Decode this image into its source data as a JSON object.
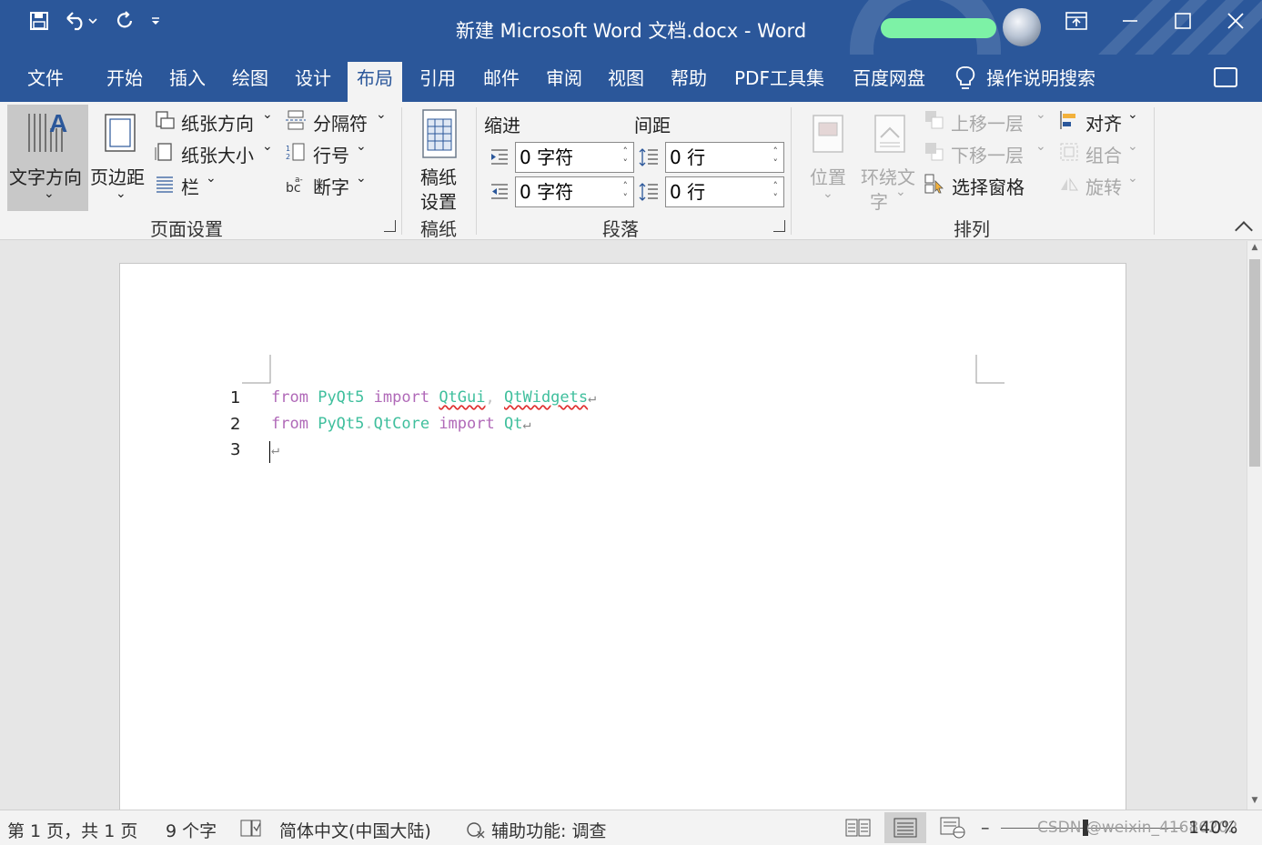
{
  "window": {
    "title": "新建 Microsoft Word 文档.docx  -  Word",
    "qat": [
      "save-icon",
      "undo-icon",
      "redo-icon",
      "customize-qat-icon"
    ],
    "controls": [
      "ribbon-display-icon",
      "minimize-icon",
      "maximize-icon",
      "close-icon"
    ]
  },
  "tabs": [
    "文件",
    "开始",
    "插入",
    "绘图",
    "设计",
    "布局",
    "引用",
    "邮件",
    "审阅",
    "视图",
    "帮助",
    "PDF工具集",
    "百度网盘"
  ],
  "active_tab": "布局",
  "tell_me": "操作说明搜索",
  "ribbon": {
    "page_setup": {
      "text_direction": "文字方向",
      "margins": "页边距",
      "orientation": "纸张方向",
      "size": "纸张大小",
      "columns": "栏",
      "breaks": "分隔符",
      "line_numbers": "行号",
      "hyphenation": "断字",
      "label": "页面设置"
    },
    "draft_paper": {
      "button_line1": "稿纸",
      "button_line2": "设置",
      "label": "稿纸"
    },
    "paragraph": {
      "indent_title": "缩进",
      "spacing_title": "间距",
      "indent_left": "0 字符",
      "indent_right": "0 字符",
      "spacing_before": "0 行",
      "spacing_after": "0 行",
      "label": "段落"
    },
    "arrange": {
      "position": "位置",
      "wrap_line1": "环绕文",
      "wrap_line2": "字",
      "bring_forward": "上移一层",
      "send_backward": "下移一层",
      "selection_pane": "选择窗格",
      "align": "对齐",
      "group": "组合",
      "rotate": "旋转",
      "label": "排列"
    }
  },
  "document": {
    "line_numbers": [
      "1",
      "2",
      "3"
    ],
    "line1": {
      "kw1": "from",
      "mod1": "PyQt5",
      "kw2": "import",
      "mod2": "QtGui",
      "punct": ",",
      "mod3": "QtWidgets"
    },
    "line2": {
      "kw1": "from",
      "mod1": "PyQt5",
      "punct": ".",
      "mod2": "QtCore",
      "kw2": "import",
      "mod3": "Qt"
    },
    "paragraph_mark": "↵"
  },
  "status": {
    "page": "第 1 页，共 1 页",
    "words": "9 个字",
    "language": "简体中文(中国大陆)",
    "accessibility": "辅助功能: 调查",
    "zoom_minus": "–",
    "zoom": "140%",
    "watermark": "CSDN @weixin_41686202"
  },
  "colors": {
    "brand": "#2b579a",
    "keyword": "#b069b8",
    "module": "#3fbf9d",
    "account_pill": "#7df2a6"
  }
}
